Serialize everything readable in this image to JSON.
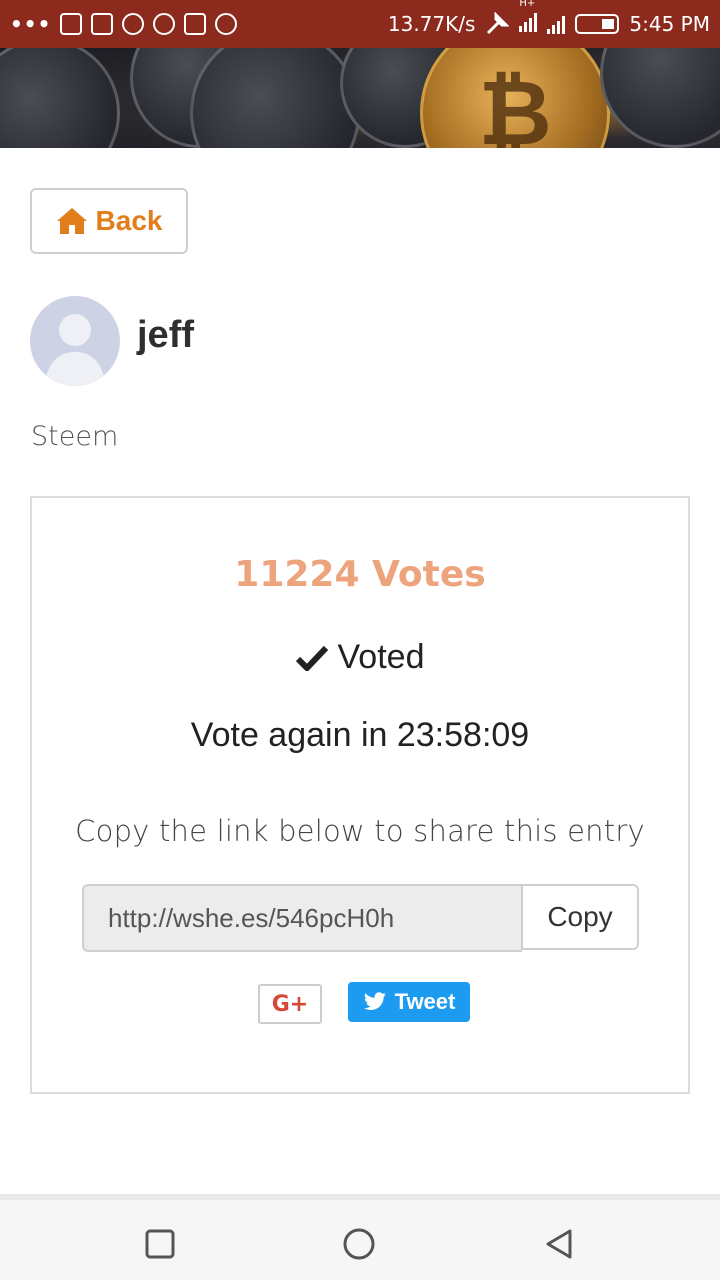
{
  "status_bar": {
    "net_speed": "13.77K/s",
    "network_type": "H+",
    "time": "5:45 PM",
    "icons": [
      "more-dots-icon",
      "sim-icon",
      "image-icon",
      "chat-icon",
      "shield-icon",
      "no-signal-icon",
      "app-icon",
      "wrench-icon",
      "signal-icon",
      "battery-icon"
    ]
  },
  "header": {
    "banner_icon": "bitcoin-coins-banner"
  },
  "nav": {
    "back_label": "Back",
    "back_icon": "home-icon"
  },
  "profile": {
    "name": "jeff",
    "platform": "Steem"
  },
  "vote_card": {
    "votes_text": "11224 Votes",
    "votes_color": "#eda37c",
    "voted_label": "Voted",
    "vote_again_text": "Vote again in 23:58:09",
    "share_prompt": "Copy the link below to share this entry",
    "share_link": "http://wshe.es/546pcH0h",
    "copy_label": "Copy",
    "gplus_label": "G+",
    "gplus_color": "#d34836",
    "tweet_label": "Tweet",
    "tweet_color": "#1d9bf0"
  },
  "accent_color": "#e27d1b",
  "system_nav": {
    "items": [
      "recents-square-icon",
      "home-circle-icon",
      "back-triangle-icon"
    ]
  }
}
